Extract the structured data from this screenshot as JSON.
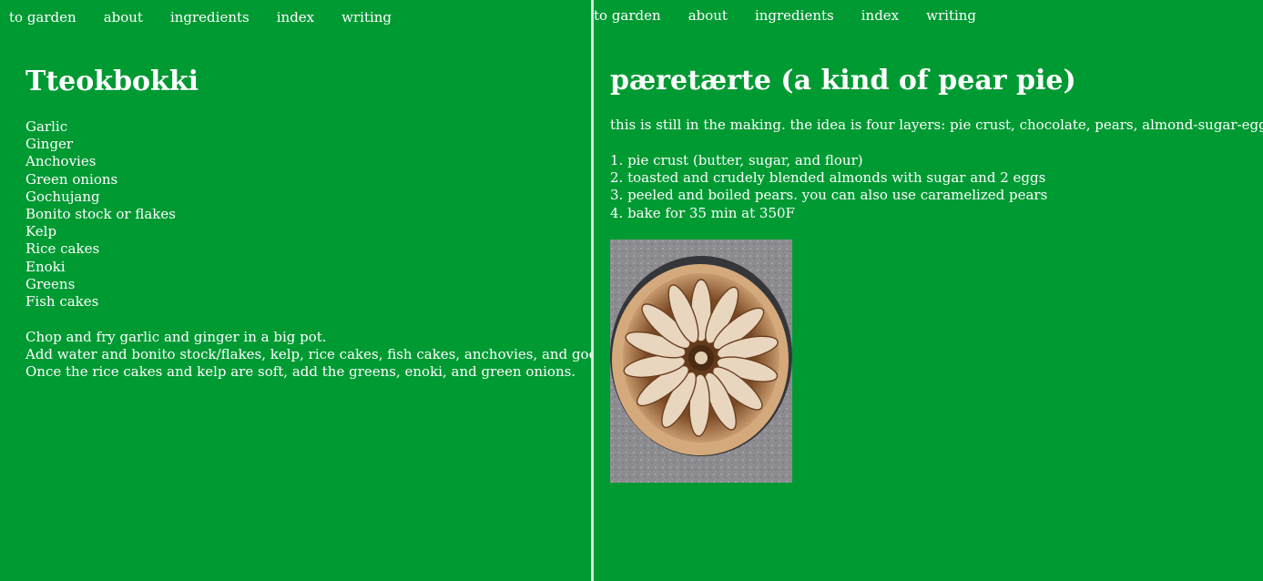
{
  "left": {
    "nav": [
      "to garden",
      "about",
      "ingredients",
      "index",
      "writing"
    ],
    "title": "Tteokbokki",
    "ingredients": [
      "Garlic",
      "Ginger",
      "Anchovies",
      "Green onions",
      "Gochujang",
      "Bonito stock or flakes",
      "Kelp",
      "Rice cakes",
      "Enoki",
      "Greens",
      "Fish cakes"
    ],
    "steps": [
      "Chop and fry garlic and ginger in a big pot.",
      "Add water and bonito stock/flakes, kelp, rice cakes, fish cakes, anchovies, and gochujang.",
      "Once the rice cakes and kelp are soft, add the greens, enoki, and green onions."
    ]
  },
  "right": {
    "nav": [
      "to garden",
      "about",
      "ingredients",
      "index",
      "writing"
    ],
    "title": "pæretærte (a kind of pear pie)",
    "intro": "this is still in the making. the idea is four layers: pie crust, chocolate, pears, almond-sugar-egg paste.",
    "steps": [
      "1. pie crust (butter, sugar, and flour)",
      "2. toasted and crudely blended almonds with sugar and 2 eggs",
      "3. peeled and boiled pears. you can also use caramelized pears",
      "4. bake for 35 min at 350F"
    ]
  },
  "colors": {
    "background": "#009a33",
    "text": "#ffffff",
    "divider": "#d9ead9"
  }
}
